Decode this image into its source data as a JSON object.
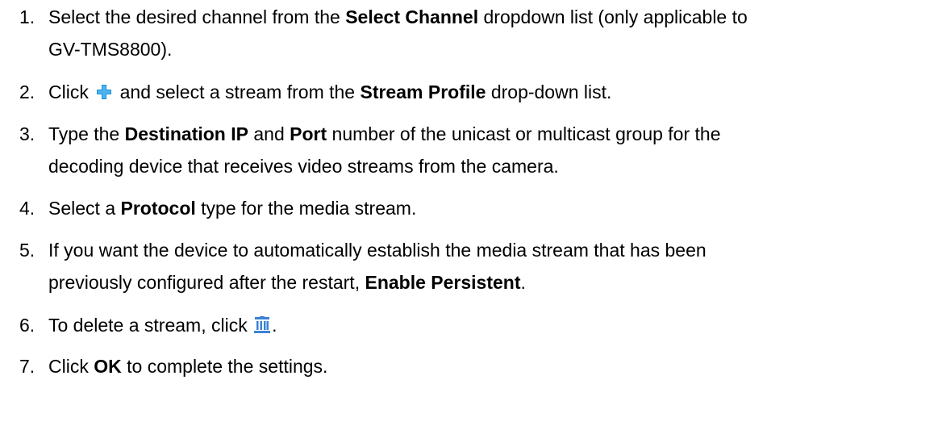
{
  "steps": [
    {
      "num": "1.",
      "pre": "Select the desired channel from the ",
      "bold": "Select Channel",
      "post": " dropdown list (only applicable to",
      "line2": "GV-TMS8800)."
    },
    {
      "num": "2.",
      "pre": "Click ",
      "icon": "plus-icon",
      "mid": " and select a stream from the ",
      "bold": "Stream Profile",
      "post": " drop-down list."
    },
    {
      "num": "3.",
      "pre": "Type the ",
      "bold": "Destination IP",
      "and": " and ",
      "bold2": "Port",
      "post": " number of the unicast or multicast group for the",
      "line2": "decoding device that receives video streams from the camera."
    },
    {
      "num": "4.",
      "pre": "Select a ",
      "bold": "Protocol",
      "post": " type for the media stream."
    },
    {
      "num": "5.",
      "pre": "If you want the device to automatically establish the media stream that has been",
      "line2_pre": "previously configured after the restart, ",
      "bold": "Enable Persistent",
      "post": "."
    },
    {
      "num": "6.",
      "pre": "To delete a stream, click ",
      "icon": "trash-icon",
      "post": "."
    },
    {
      "num": "7.",
      "pre": "Click ",
      "bold": "OK",
      "post": " to complete the settings."
    }
  ],
  "icon_colors": {
    "plus": "#1e8fd8",
    "trash": "#3b82d6"
  }
}
